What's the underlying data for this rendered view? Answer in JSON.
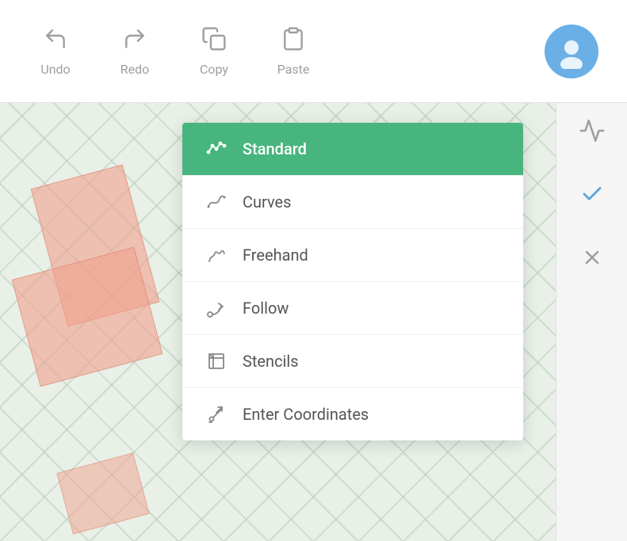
{
  "toolbar": {
    "undo_label": "Undo",
    "redo_label": "Redo",
    "copy_label": "Copy",
    "paste_label": "Paste"
  },
  "dropdown": {
    "items": [
      {
        "id": "standard",
        "label": "Standard",
        "active": true
      },
      {
        "id": "curves",
        "label": "Curves",
        "active": false
      },
      {
        "id": "freehand",
        "label": "Freehand",
        "active": false
      },
      {
        "id": "follow",
        "label": "Follow",
        "active": false
      },
      {
        "id": "stencils",
        "label": "Stencils",
        "active": false
      },
      {
        "id": "enter-coordinates",
        "label": "Enter Coordinates",
        "active": false
      }
    ]
  },
  "right_panel": {
    "chart_icon_title": "Chart/Line Tool",
    "check_icon_title": "Confirm",
    "close_icon_title": "Cancel"
  }
}
